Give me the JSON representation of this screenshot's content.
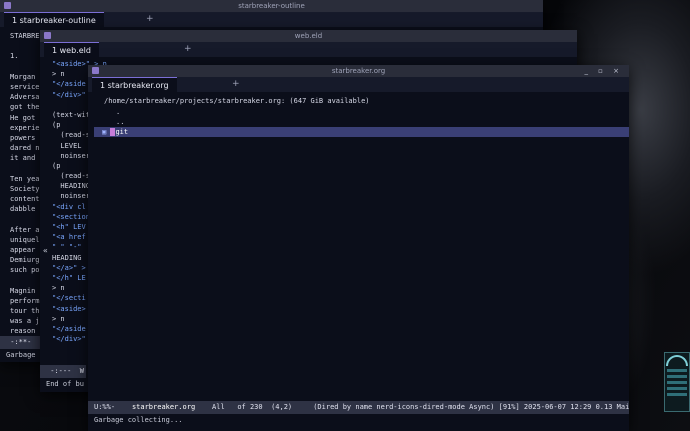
{
  "win1": {
    "title": "starbreaker-outline",
    "tab": "1 starbreaker-outline",
    "plus": "+",
    "lines": [
      "STARBRE",
      "",
      "1.",
      "",
      "Morgan",
      "service",
      "Adversa",
      "got the",
      "He got",
      "experie",
      "powers",
      "dared n",
      "it and",
      "",
      "Ten yea",
      "Society",
      "content",
      "dabble",
      "",
      "After a",
      "uniquel",
      "appear",
      "Demiurg",
      "such po",
      "",
      "Magnin",
      "perform",
      "tour th",
      "was a j",
      "reason"
    ],
    "modeline": " -:**-  ",
    "echo": "Garbage"
  },
  "win2": {
    "title": "web.eld",
    "tab": "1 web.eld",
    "plus": "+",
    "lines": [
      "\"<aside>\" > n",
      "> n",
      "\"</aside",
      "\"</div>\"",
      "",
      "(text-with",
      "(p",
      "  (read-s",
      "  LEVEL",
      "  noinser",
      "(p",
      "  (read-s",
      "  HEADING",
      "  noinser",
      "\"<div cl",
      "\"<section",
      "\"<h\" LEV",
      "\"<a href",
      "\" \" \"-\"",
      "HEADING",
      "\"</a>\" >",
      "\"</h\" LE",
      "> n",
      "\"</secti",
      "\"<aside>",
      "> n",
      "\"</aside",
      "\"</div>\""
    ],
    "modeline": " -:---  W",
    "echo": "End of bu"
  },
  "win3": {
    "title": "starbreaker.org",
    "controls": "_ ▫ ×",
    "tab": "1 starbreaker.org",
    "plus": "+",
    "header": "/home/starbreaker/projects/starbreaker.org: (647 GiB available)",
    "entries": [
      ".",
      "..",
      "git"
    ],
    "modeline": {
      "state": "U:%%-",
      "buffer": "starbreaker.org",
      "position": "All",
      "count": "of 230",
      "coords": "(4,2)",
      "modes": "(Dired by name nerd-icons-dired-mode Async) [91%] 2025-06-07 12:29 0.13 Mai"
    },
    "echo": "Garbage collecting..."
  },
  "side_arrow": "«",
  "colors": {
    "accent": "#7b6fd6",
    "highlight": "#3a3f75",
    "string": "#7aa7ff",
    "cursor": "#c77dd9"
  }
}
